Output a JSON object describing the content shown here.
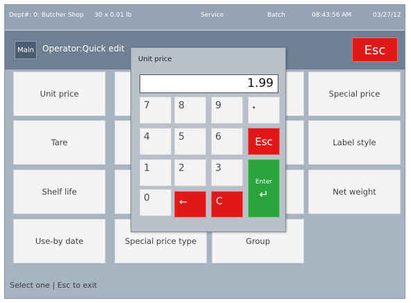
{
  "status_bar": {
    "dept": "Dept#: 0: Butcher Shop",
    "scale": "30 x 0.01 lb",
    "mode": "Service",
    "batch": "Batch",
    "time": "08:43:56 AM",
    "date": "03/27/12"
  },
  "header": {
    "main_button": "Main",
    "operator": "Operator:Quick edit",
    "esc_button": "Esc"
  },
  "tiles": {
    "unit_price": "Unit price",
    "special_price": "Special price",
    "tare": "Tare",
    "label_style": "Label style",
    "shelf_life": "Shelf life",
    "net_weight": "Net weight",
    "use_by_date": "Use-by date",
    "special_price_type": "Special price type",
    "group": "Group"
  },
  "footer": {
    "hint": "Select one | Esc to exit"
  },
  "dialog": {
    "title": "Unit price",
    "value": "1.99",
    "keys": {
      "k7": "7",
      "k8": "8",
      "k9": "9",
      "dot": ".",
      "k4": "4",
      "k5": "5",
      "k6": "6",
      "esc": "Esc",
      "k1": "1",
      "k2": "2",
      "k3": "3",
      "k0": "0",
      "backspace": "←",
      "clear": "C",
      "enter": "Enter",
      "enter_arrow": "↵"
    }
  },
  "colors": {
    "accent_red": "#e01818",
    "enter_green": "#28a43a",
    "header_bar": "#6f7f94",
    "background": "#a9b4c3"
  }
}
